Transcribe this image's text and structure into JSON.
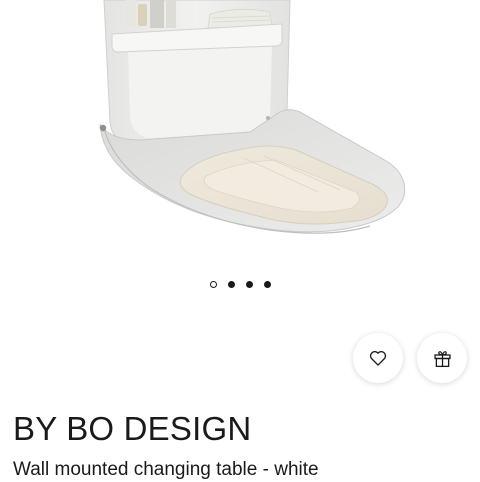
{
  "product": {
    "image_alt": "Wall mounted changing table",
    "carousel": {
      "total": 4,
      "active": 0
    },
    "brand": "BY BO DESIGN",
    "title": "Wall mounted changing table - white"
  },
  "actions": {
    "favorite_icon": "heart-icon",
    "gift_icon": "gift-icon"
  },
  "colors": {
    "text": "#1a1a1a",
    "background": "#ffffff"
  }
}
